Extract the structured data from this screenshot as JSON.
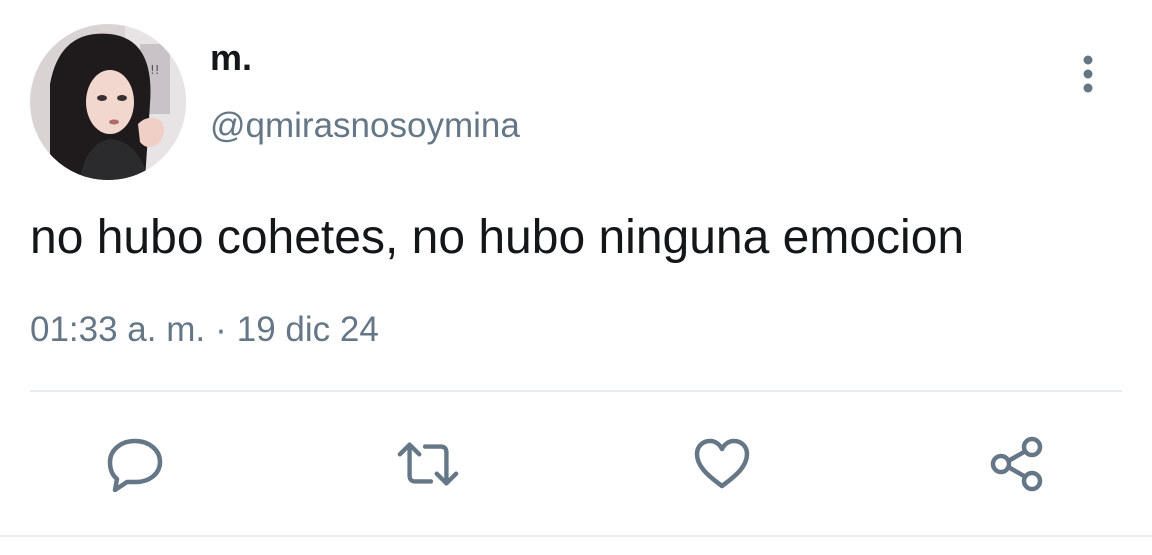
{
  "tweet": {
    "author": {
      "display_name": "m.",
      "handle": "@qmirasnosoymina",
      "avatar_icon": "avatar-image"
    },
    "text": "no hubo cohetes, no hubo ninguna emocion",
    "time": "01:33 a. m.",
    "separator": "·",
    "date": "19 dic 24",
    "more_icon": "vertical-ellipsis-icon"
  },
  "actions": [
    {
      "name": "reply",
      "icon": "comment-icon"
    },
    {
      "name": "retweet",
      "icon": "retweet-icon"
    },
    {
      "name": "like",
      "icon": "heart-icon"
    },
    {
      "name": "share",
      "icon": "share-icon"
    }
  ],
  "colors": {
    "text": "#14171a",
    "secondary": "#657786",
    "divider": "#e6ecf0"
  }
}
